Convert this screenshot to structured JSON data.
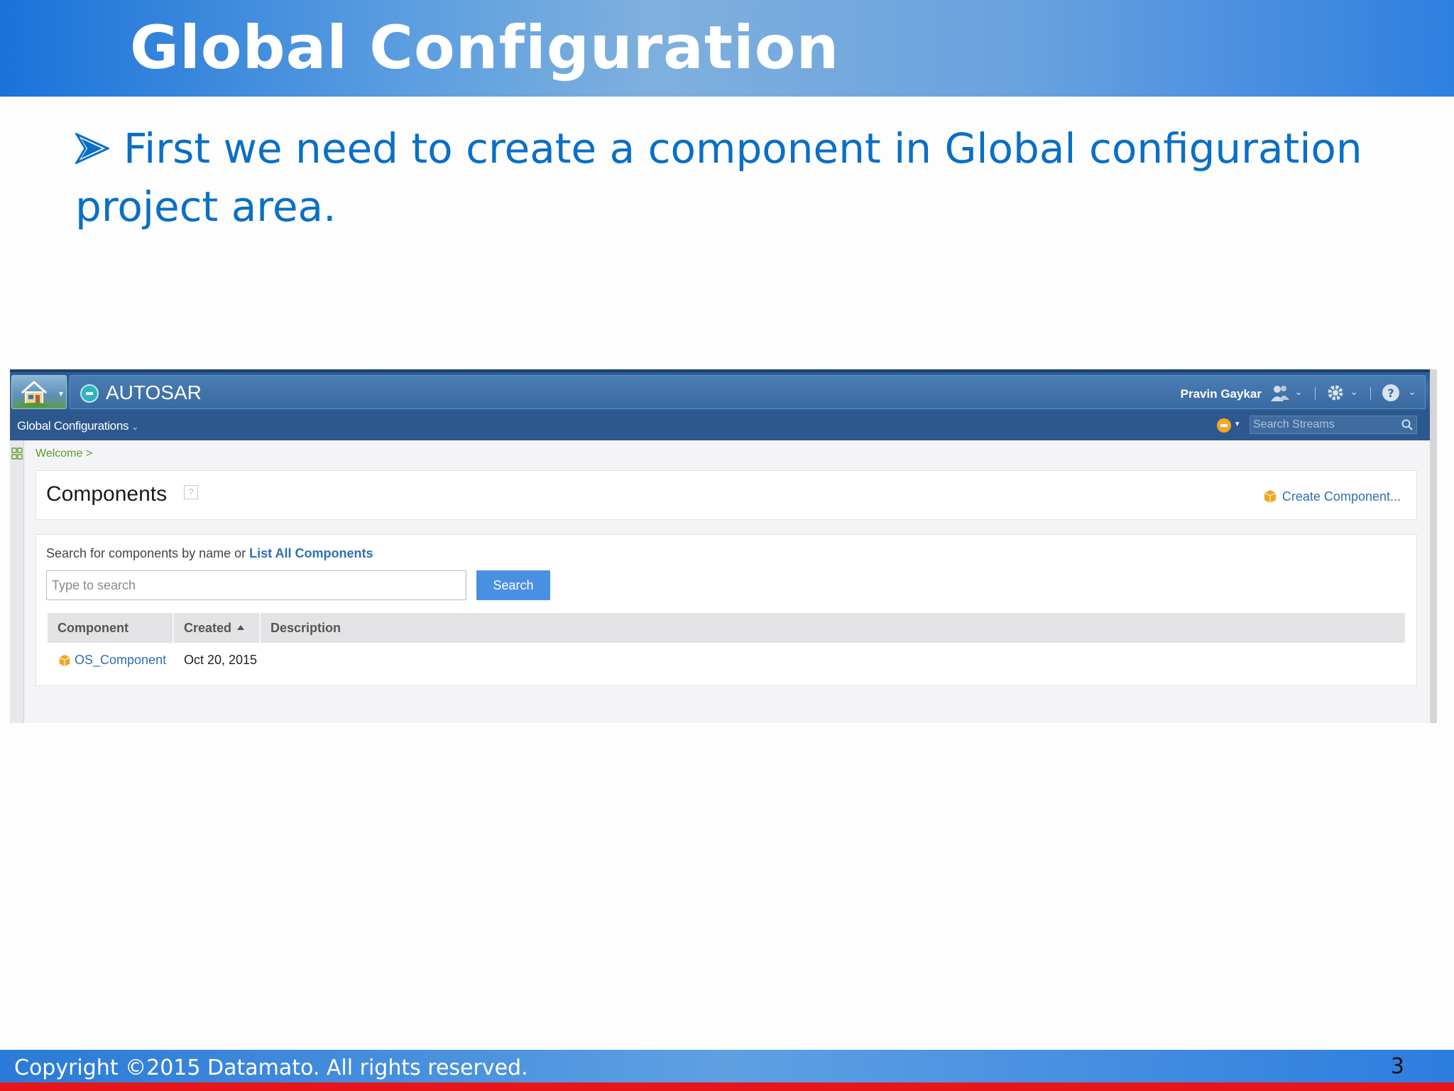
{
  "slide": {
    "title": "Global Configuration",
    "bullet": "First  we need to create a component in Global configuration project area.",
    "footer": "Copyright ©2015 Datamato. All rights reserved.",
    "page_number": "3"
  },
  "app": {
    "name": "AUTOSAR",
    "user": "Pravin Gaykar",
    "project_area": "Global Configurations",
    "search_streams_placeholder": "Search Streams",
    "breadcrumb": "Welcome >"
  },
  "components_panel": {
    "title": "Components",
    "help": "?",
    "create_link": "Create Component..."
  },
  "search_panel": {
    "hint": "Search for components by name or ",
    "list_all_link": "List All Components",
    "input_placeholder": "Type to search",
    "search_button": "Search"
  },
  "table": {
    "columns": [
      "Component",
      "Created",
      "Description"
    ],
    "rows": [
      {
        "component": "OS_Component",
        "created": "Oct 20, 2015",
        "description": ""
      }
    ]
  },
  "colors": {
    "title_band": "#5b9ee0",
    "bullet_text": "#0a6fc6",
    "app_header": "#2d588e",
    "link": "#2f6fb3",
    "search_button": "#4a90e2",
    "footer_red": "#e8161b"
  }
}
